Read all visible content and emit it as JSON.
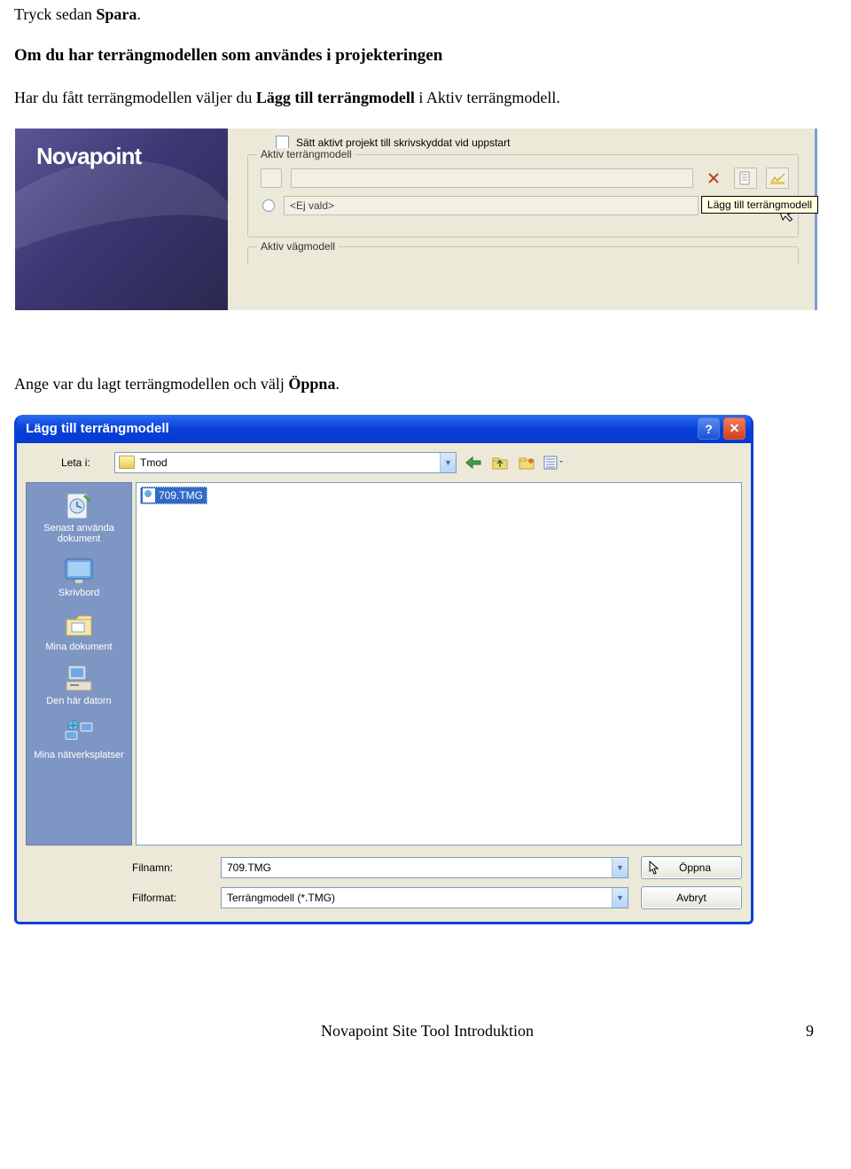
{
  "doc": {
    "line1_a": "Tryck sedan ",
    "line1_b": "Spara",
    "line1_c": ".",
    "heading": "Om du har terrängmodellen som användes i projekteringen",
    "body_a": "Har du fått terrängmodellen väljer du ",
    "body_b": "Lägg till terrängmodell",
    "body_c": " i Aktiv terrängmodell.",
    "line2_a": "Ange var du lagt terrängmodellen och välj ",
    "line2_b": "Öppna",
    "line2_c": "."
  },
  "np": {
    "logo": "Novapoint",
    "checkbox_label": "Sätt aktivt projekt till skrivskyddat vid uppstart",
    "group1_title": "Aktiv terrängmodell",
    "not_selected": "<Ej vald>",
    "tooltip": "Lägg till terrängmodell",
    "group2_title": "Aktiv vägmodell"
  },
  "dlg": {
    "title": "Lägg till terrängmodell",
    "leta_i": "Leta i:",
    "folder": "Tmod",
    "selected_file": "709.TMG",
    "places": {
      "recent": "Senast använda dokument",
      "desktop": "Skrivbord",
      "mydocs": "Mina dokument",
      "mycomputer": "Den här datorn",
      "network": "Mina nätverksplatser"
    },
    "filnamn_label": "Filnamn:",
    "filnamn_value": "709.TMG",
    "filformat_label": "Filformat:",
    "filformat_value": "Terrängmodell (*.TMG)",
    "open_btn": "Öppna",
    "cancel_btn": "Avbryt"
  },
  "footer": {
    "text": "Novapoint Site Tool Introduktion",
    "page": "9"
  }
}
